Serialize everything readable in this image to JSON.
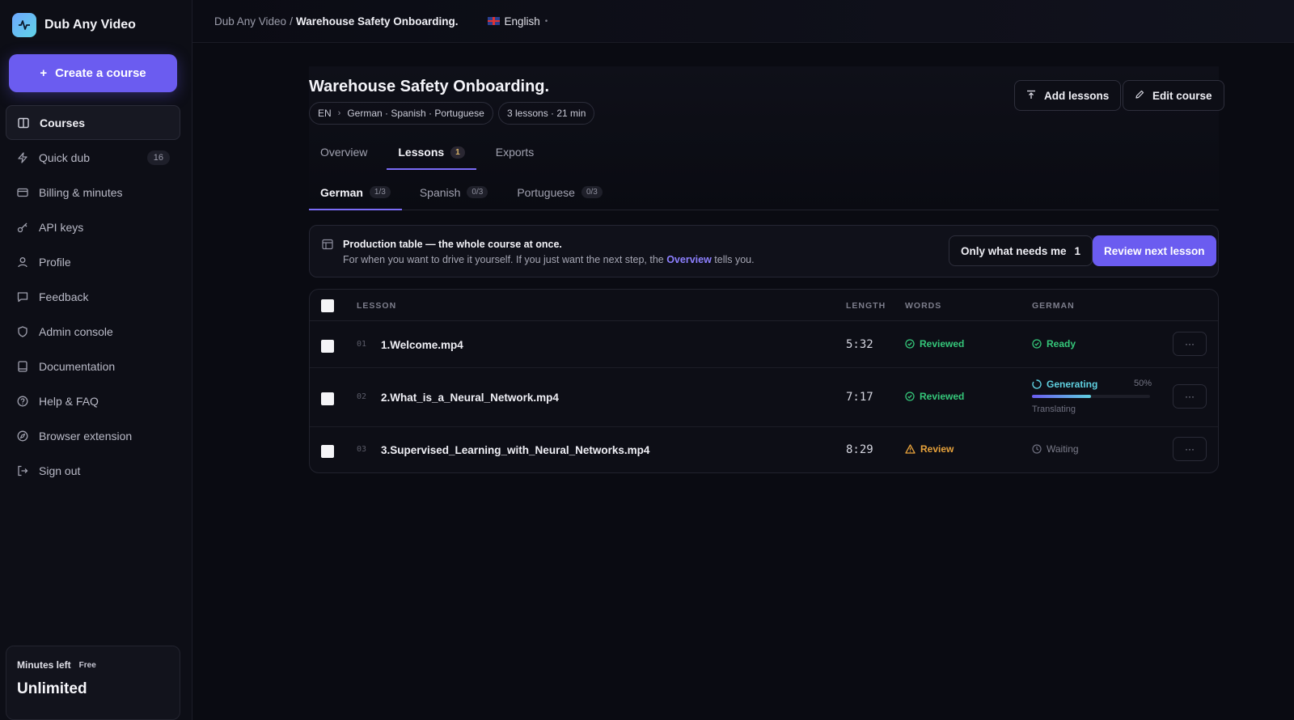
{
  "sidebar": {
    "brand": "Dub Any Video",
    "create_label": "Create a course",
    "items": [
      {
        "label": "Courses",
        "icon": "book-icon",
        "active": true
      },
      {
        "label": "Quick dub",
        "icon": "lightning-icon",
        "badge": "16"
      },
      {
        "label": "Billing & minutes",
        "icon": "credit-card-icon"
      },
      {
        "label": "API keys",
        "icon": "key-icon"
      },
      {
        "label": "Profile",
        "icon": "user-icon"
      },
      {
        "label": "Feedback",
        "icon": "message-icon"
      },
      {
        "label": "Admin console",
        "icon": "shield-icon"
      },
      {
        "label": "Documentation",
        "icon": "document-icon"
      },
      {
        "label": "Help & FAQ",
        "icon": "help-icon"
      },
      {
        "label": "Browser extension",
        "icon": "compass-icon"
      },
      {
        "label": "Sign out",
        "icon": "sign-out-icon"
      }
    ],
    "minutes": {
      "label": "Minutes left",
      "plan": "Free",
      "value": "Unlimited"
    }
  },
  "topbar": {
    "crumb_root": "Dub Any Video",
    "crumb_sep": "/",
    "crumb_current": "Warehouse Safety Onboarding.",
    "language": "English"
  },
  "course": {
    "title": "Warehouse Safety Onboarding.",
    "source_lang": "EN",
    "target_langs": "German · Spanish · Portuguese",
    "summary": "3 lessons · 21 min",
    "add_lessons_label": "Add lessons",
    "edit_course_label": "Edit course"
  },
  "tabs": [
    {
      "label": "Overview"
    },
    {
      "label": "Lessons",
      "count": "1",
      "active": true
    },
    {
      "label": "Exports"
    }
  ],
  "language_tabs": [
    {
      "label": "German",
      "count": "1/3",
      "active": true
    },
    {
      "label": "Spanish",
      "count": "0/3"
    },
    {
      "label": "Portuguese",
      "count": "0/3"
    }
  ],
  "banner": {
    "title": "Production table — the whole course at once.",
    "text_before": "For when you want to drive it yourself. If you just want the next step, the ",
    "link": "Overview",
    "text_after": " tells you.",
    "filter_label": "Only what needs me",
    "filter_count": "1",
    "review_label": "Review next lesson"
  },
  "table": {
    "headers": {
      "lesson": "LESSON",
      "length": "LENGTH",
      "words": "WORDS",
      "german": "GERMAN"
    },
    "rows": [
      {
        "num": "01",
        "name": "1.Welcome.mp4",
        "length": "5:32",
        "words": "Reviewed",
        "german": "Ready"
      },
      {
        "num": "02",
        "name": "2.What_is_a_Neural_Network.mp4",
        "length": "7:17",
        "words": "Reviewed",
        "german": "Generating",
        "progress": 0.5,
        "progress_label": "50%",
        "sub_status": "Translating"
      },
      {
        "num": "03",
        "name": "3.Supervised_Learning_with_Neural_Networks.mp4",
        "length": "8:29",
        "words": "Review",
        "german": "Waiting"
      }
    ]
  },
  "colors": {
    "accent": "#6b5cf0",
    "green": "#35c77a",
    "orange": "#e7a23b",
    "teal": "#5fd0e0"
  }
}
